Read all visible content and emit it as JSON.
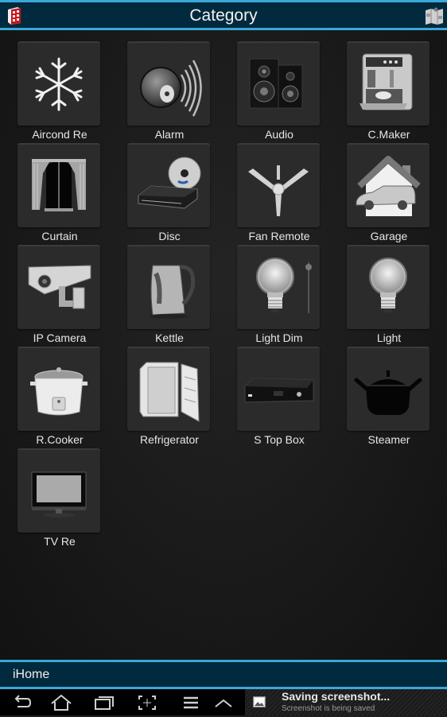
{
  "header": {
    "title": "Category",
    "left_icon": "app-grid-icon",
    "right_icon": "map-icon"
  },
  "categories": [
    {
      "label": "Aircond Re",
      "icon": "snowflake-icon"
    },
    {
      "label": "Alarm",
      "icon": "alarm-bell-icon"
    },
    {
      "label": "Audio",
      "icon": "speakers-icon"
    },
    {
      "label": "C.Maker",
      "icon": "coffee-maker-icon"
    },
    {
      "label": "Curtain",
      "icon": "curtain-icon"
    },
    {
      "label": "Disc",
      "icon": "bluray-player-icon"
    },
    {
      "label": "Fan Remote",
      "icon": "ceiling-fan-icon"
    },
    {
      "label": "Garage",
      "icon": "garage-icon"
    },
    {
      "label": "IP Camera",
      "icon": "security-camera-icon"
    },
    {
      "label": "Kettle",
      "icon": "kettle-icon"
    },
    {
      "label": "Light Dim",
      "icon": "light-bulb-dimmer-icon"
    },
    {
      "label": "Light",
      "icon": "light-bulb-icon"
    },
    {
      "label": "R.Cooker",
      "icon": "rice-cooker-icon"
    },
    {
      "label": "Refrigerator",
      "icon": "refrigerator-icon"
    },
    {
      "label": "S Top Box",
      "icon": "set-top-box-icon"
    },
    {
      "label": "Steamer",
      "icon": "pot-icon"
    },
    {
      "label": "TV Re",
      "icon": "tv-icon"
    }
  ],
  "footer": {
    "app_name": "iHome"
  },
  "navbar": {
    "buttons": [
      "back",
      "home",
      "recent-apps",
      "screenshot",
      "menu",
      "up"
    ]
  },
  "notification": {
    "title": "Saving screenshot...",
    "subtitle": "Screenshot is being saved"
  }
}
